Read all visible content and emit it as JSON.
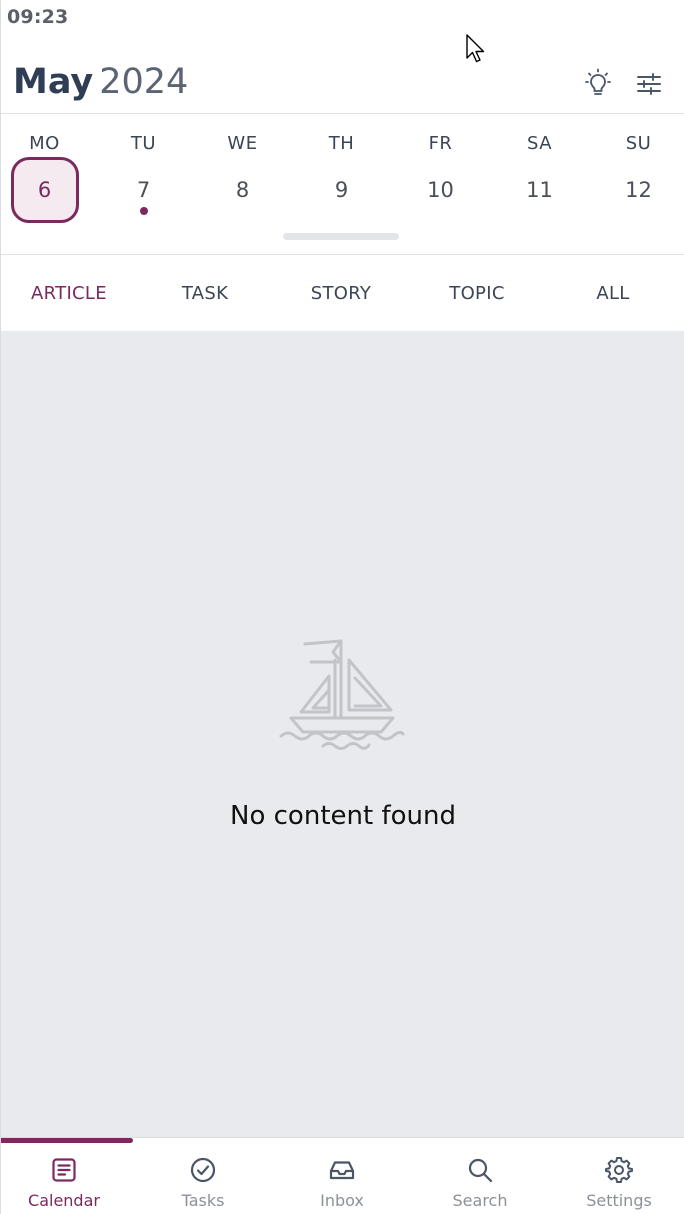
{
  "status_bar": {
    "time": "09:23"
  },
  "header": {
    "month": "May",
    "year": "2024",
    "icons": [
      "lightbulb-icon",
      "sliders-icon"
    ]
  },
  "week": {
    "days": [
      {
        "name": "MO",
        "number": "6",
        "selected": true,
        "has_event": false
      },
      {
        "name": "TU",
        "number": "7",
        "selected": false,
        "has_event": true
      },
      {
        "name": "WE",
        "number": "8",
        "selected": false,
        "has_event": false
      },
      {
        "name": "TH",
        "number": "9",
        "selected": false,
        "has_event": false
      },
      {
        "name": "FR",
        "number": "10",
        "selected": false,
        "has_event": false
      },
      {
        "name": "SA",
        "number": "11",
        "selected": false,
        "has_event": false
      },
      {
        "name": "SU",
        "number": "12",
        "selected": false,
        "has_event": false
      }
    ]
  },
  "tabs": [
    {
      "label": "ARTICLE",
      "active": true
    },
    {
      "label": "TASK",
      "active": false
    },
    {
      "label": "STORY",
      "active": false
    },
    {
      "label": "TOPIC",
      "active": false
    },
    {
      "label": "ALL",
      "active": false
    }
  ],
  "content": {
    "empty_message": "No content found",
    "empty_icon": "sailboat-icon"
  },
  "nav": {
    "items": [
      {
        "label": "Calendar",
        "icon": "calendar-icon",
        "active": true
      },
      {
        "label": "Tasks",
        "icon": "check-circle-icon",
        "active": false
      },
      {
        "label": "Inbox",
        "icon": "inbox-icon",
        "active": false
      },
      {
        "label": "Search",
        "icon": "search-icon",
        "active": false
      },
      {
        "label": "Settings",
        "icon": "gear-icon",
        "active": false
      }
    ]
  },
  "colors": {
    "accent": "#7a2a5e",
    "text": "#2f3e55",
    "muted": "#8c9099",
    "content_bg": "#e9eaee"
  }
}
